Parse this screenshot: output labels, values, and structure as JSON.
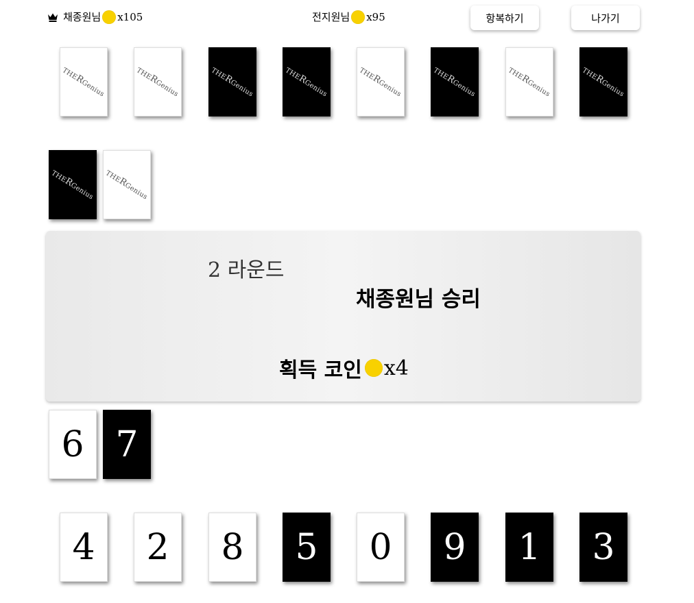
{
  "header": {
    "player1": {
      "name": "채종원님",
      "coins": "x105"
    },
    "player2": {
      "name": "전지원님",
      "coins": "x95"
    },
    "surrender_label": "항복하기",
    "exit_label": "나가기"
  },
  "card_back": {
    "logo_the": "THE",
    "logo_r": "R",
    "logo_genius": "Genius"
  },
  "opponent_hand": [
    "white",
    "white",
    "black",
    "black",
    "white",
    "black",
    "white",
    "black"
  ],
  "opponent_played": [
    "black",
    "white"
  ],
  "result": {
    "round": "2 라운드",
    "winner": "채종원님 승리",
    "gain_label": "획득 코인",
    "gain_coins": "x4"
  },
  "my_played": [
    {
      "value": "6",
      "color": "white"
    },
    {
      "value": "7",
      "color": "black"
    }
  ],
  "my_hand": [
    {
      "value": "4",
      "color": "white"
    },
    {
      "value": "2",
      "color": "white"
    },
    {
      "value": "8",
      "color": "white"
    },
    {
      "value": "5",
      "color": "black"
    },
    {
      "value": "0",
      "color": "white"
    },
    {
      "value": "9",
      "color": "black"
    },
    {
      "value": "1",
      "color": "black"
    },
    {
      "value": "3",
      "color": "black"
    }
  ],
  "colors": {
    "coin": "#f8d100",
    "card_black": "#000000",
    "card_white": "#ffffff"
  }
}
